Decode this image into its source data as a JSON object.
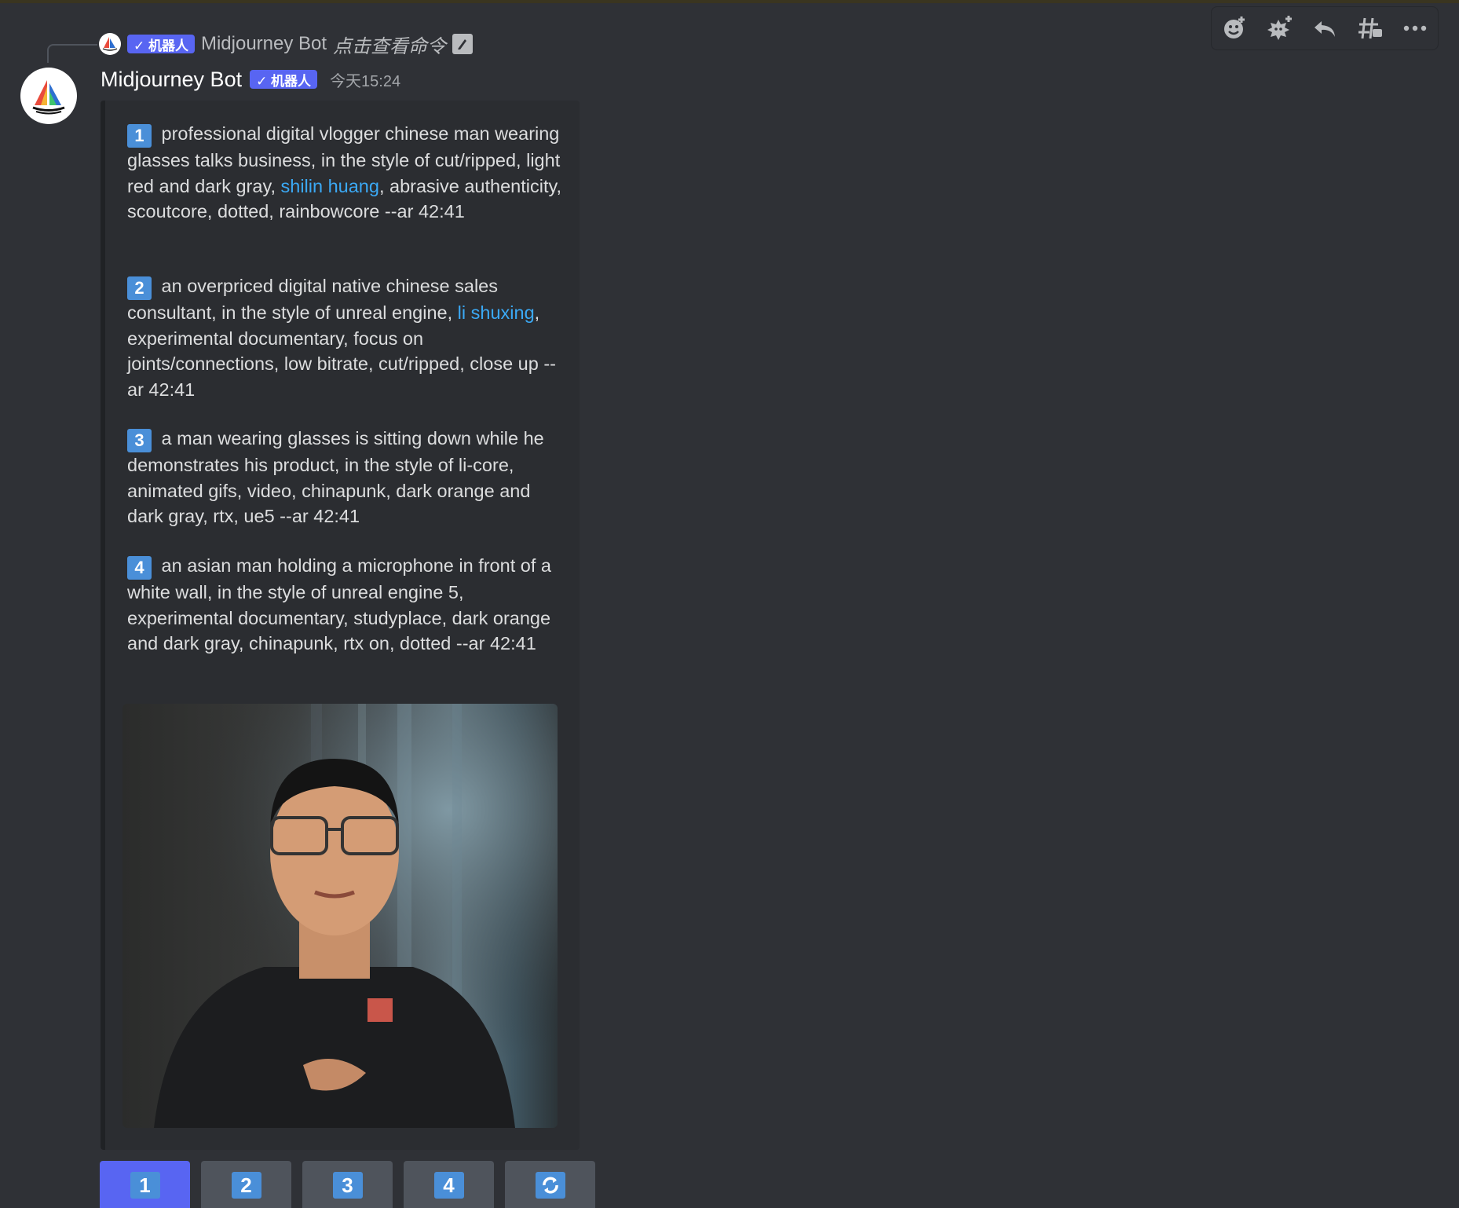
{
  "reply": {
    "badge": "✓ 机器人",
    "name": "Midjourney Bot",
    "command": "点击查看命令"
  },
  "message": {
    "author": "Midjourney Bot",
    "badge": "✓ 机器人",
    "timestamp": "今天15:24"
  },
  "prompts": [
    {
      "num": "1",
      "text_a": " professional digital vlogger chinese man wearing glasses talks business, in the style of cut/ripped, light red and dark gray, ",
      "link": "shilin huang",
      "text_b": ", abrasive authenticity, scoutcore, dotted, rainbowcore --ar 42:41"
    },
    {
      "num": "2",
      "text_a": " an overpriced digital native chinese sales consultant, in the style of unreal engine, ",
      "link": "li shuxing",
      "text_b": ", experimental documentary, focus on joints/connections, low bitrate, cut/ripped, close up --ar 42:41"
    },
    {
      "num": "3",
      "text_a": " a man wearing glasses is sitting down while he demonstrates his product, in the style of li-core, animated gifs, video, chinapunk, dark orange and dark gray, rtx, ue5 --ar 42:41"
    },
    {
      "num": "4",
      "text_a": " an asian man holding a microphone in front of a white wall, in the style of unreal engine 5, experimental documentary, studyplace, dark orange and dark gray, chinapunk, rtx on, dotted --ar 42:41"
    }
  ],
  "buttons": [
    "1",
    "2",
    "3",
    "4"
  ],
  "toolbar": [
    "add-reaction-icon",
    "add-super-reaction-icon",
    "reply-icon",
    "create-thread-icon",
    "more-icon"
  ],
  "colors": {
    "background": "#2f3136",
    "accent": "#5865f2",
    "link": "#3ba9f5",
    "number_badge": "#4a8fd8"
  }
}
